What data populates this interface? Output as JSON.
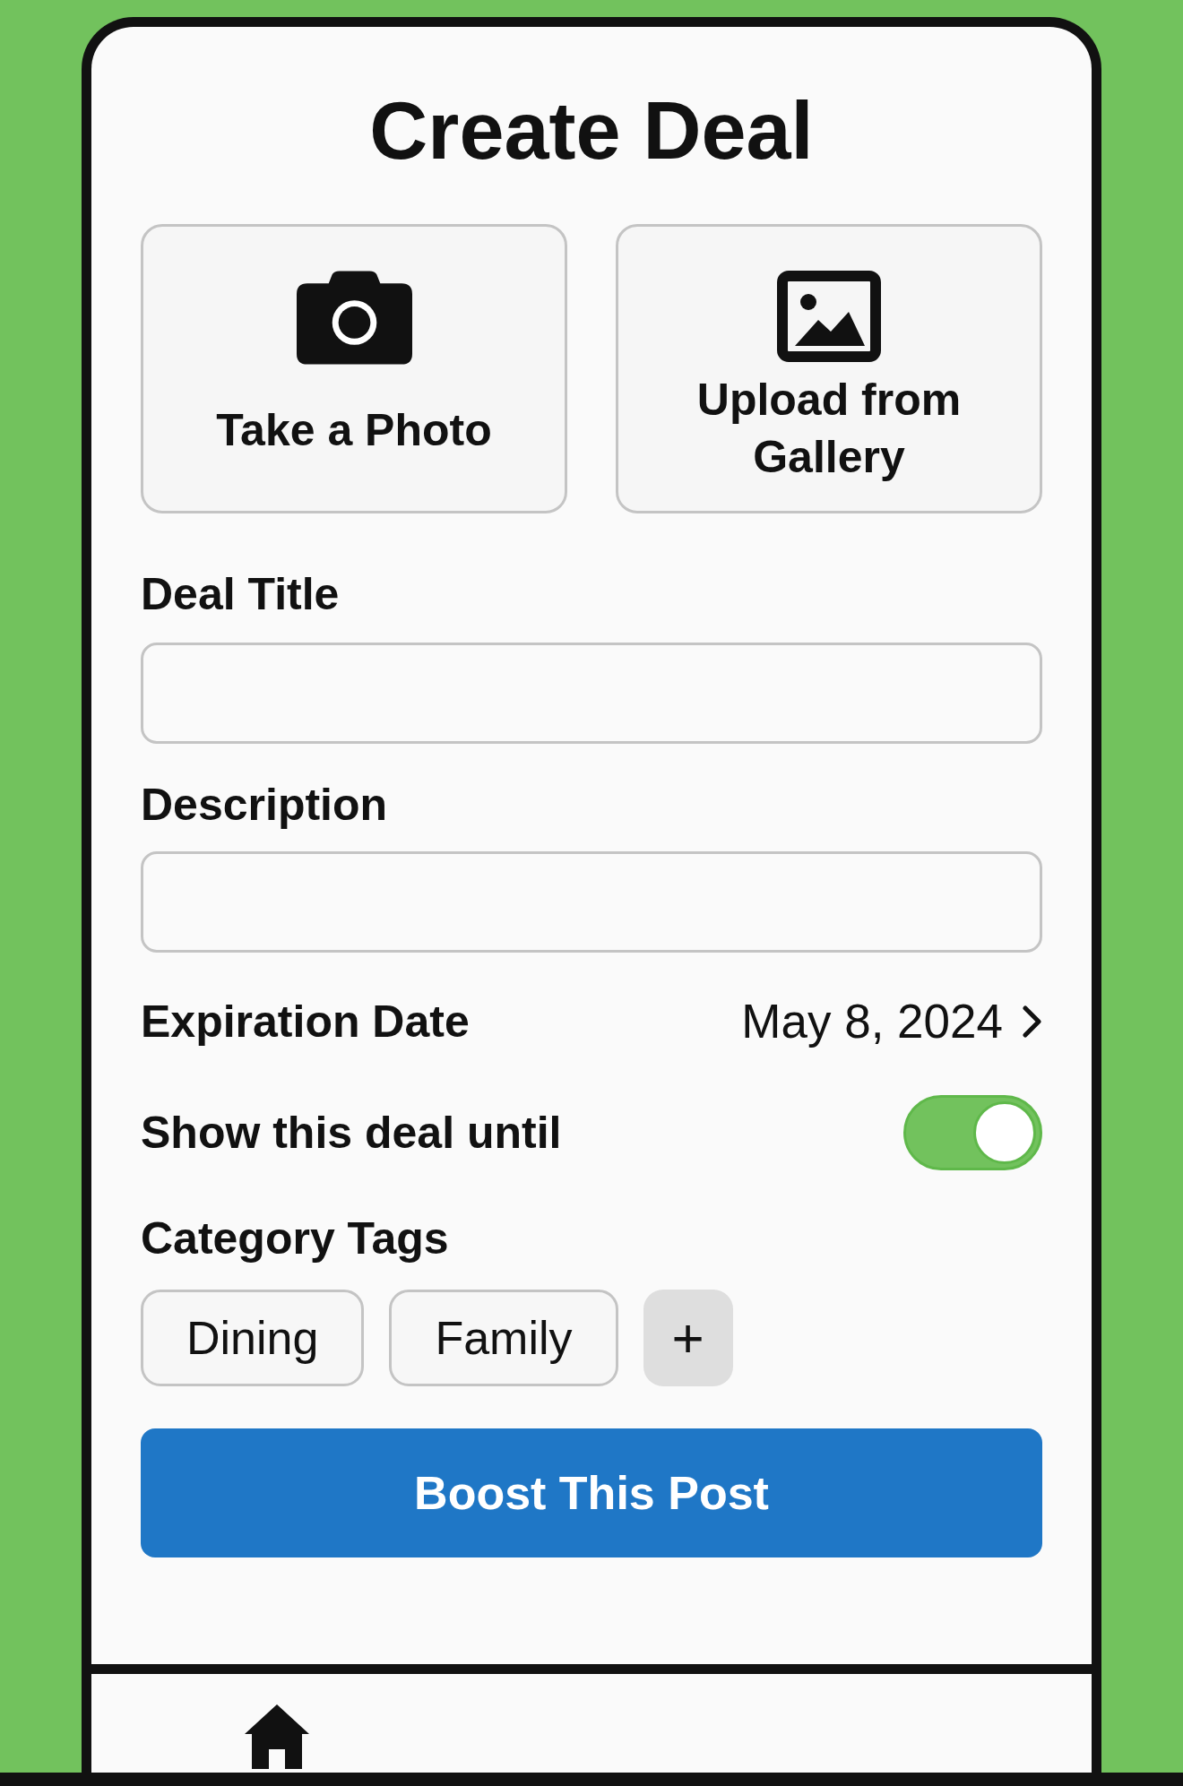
{
  "screen": {
    "title": "Create Deal"
  },
  "media_buttons": [
    {
      "kind": "camera",
      "label": "Take a Photo"
    },
    {
      "kind": "gallery",
      "label": "Upload from Gallery"
    }
  ],
  "fields": [
    {
      "label": "Deal Title"
    },
    {
      "label": "Description"
    }
  ],
  "expiration_date": {
    "label": "Expiration Date",
    "value": "May 8, 2024"
  },
  "show_until": {
    "label": "Show this deal until",
    "on": true
  },
  "category_tags": {
    "label": "Category Tags",
    "tags": [
      {
        "label": "Dining"
      },
      {
        "label": "Family"
      }
    ],
    "add_button": "+"
  },
  "primary_button": {
    "label": "Boost This Post"
  },
  "bottom_nav": {
    "items": [
      {
        "kind": "home"
      }
    ]
  }
}
